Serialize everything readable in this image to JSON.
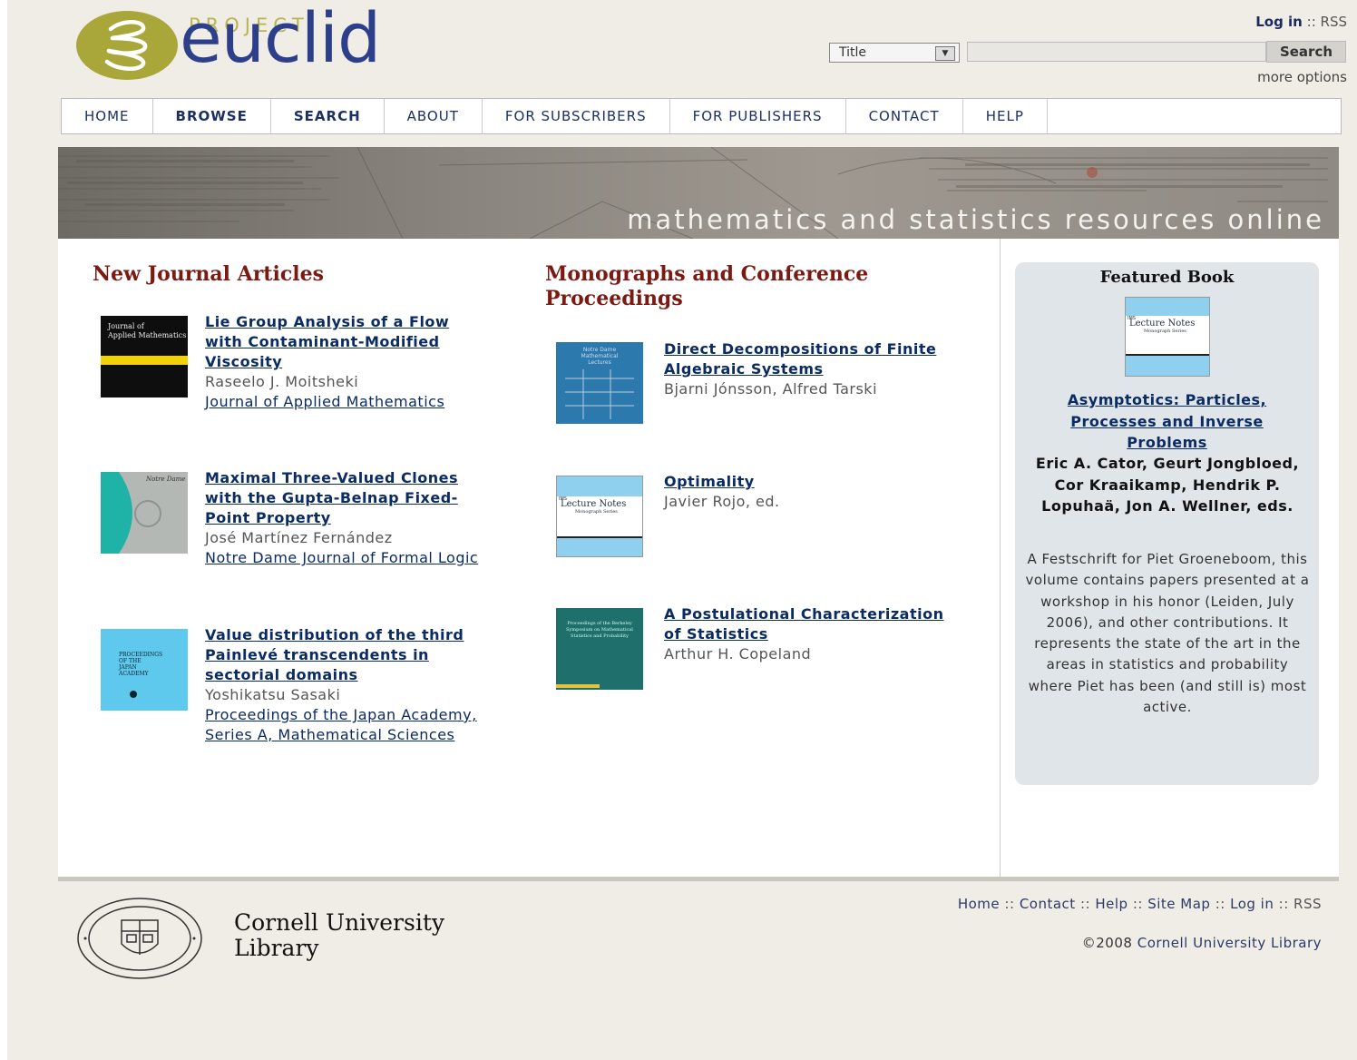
{
  "header": {
    "project": "PROJECT",
    "brand": "euclid",
    "login_label": "Log in",
    "sep": "::",
    "rss": "RSS",
    "search_field_selected": "Title",
    "search_value": "",
    "search_button": "Search",
    "more_options": "more options"
  },
  "nav": [
    "HOME",
    "BROWSE",
    "SEARCH",
    "ABOUT",
    "FOR SUBSCRIBERS",
    "FOR PUBLISHERS",
    "CONTACT",
    "HELP"
  ],
  "banner": {
    "text": "mathematics and statistics resources online"
  },
  "journals": {
    "heading": "New Journal Articles",
    "items": [
      {
        "title": "Lie Group Analysis of a Flow with Contaminant-Modified Viscosity",
        "author": "Raseelo J. Moitsheki",
        "journal": "Journal of Applied Mathematics"
      },
      {
        "title": "Maximal Three-Valued Clones with the Gupta-Belnap Fixed-Point Property",
        "author": "José Martínez Fernández",
        "journal": "Notre Dame Journal of Formal Logic"
      },
      {
        "title": "Value distribution of the third Painlevé transcendents in sectorial domains",
        "author": "Yoshikatsu Sasaki",
        "journal": "Proceedings of the Japan Academy, Series A, Mathematical Sciences"
      }
    ]
  },
  "monographs": {
    "heading": "Monographs and Conference Proceedings",
    "items": [
      {
        "title": "Direct Decompositions of Finite Algebraic Systems",
        "author": "Bjarni Jónsson, Alfred Tarski"
      },
      {
        "title": "Optimality",
        "author": "Javier Rojo, ed."
      },
      {
        "title": "A Postulational Characterization of Statistics",
        "author": "Arthur H. Copeland"
      }
    ]
  },
  "featured": {
    "heading": "Featured Book",
    "title": "Asymptotics: Particles, Processes and Inverse Problems",
    "authors": "Eric A. Cator, Geurt Jongbloed, Cor Kraaikamp, Hendrik P. Lopuhaä, Jon A. Wellner, eds.",
    "description": "A Festschrift for Piet Groeneboom, this volume contains papers presented at a workshop in his honor (Leiden, July 2006), and other contributions. It represents the state of the art in the areas in statistics and probability where Piet has been (and still is) most active."
  },
  "covers": {
    "jam": {
      "line1": "Journal of",
      "line2": "Applied Mathematics"
    },
    "ndj": {
      "line1": "Notre Dame"
    },
    "lecture": {
      "ims": "IMS",
      "line1": "Lecture Notes",
      "line2": "Monograph Series"
    },
    "ndml": {
      "line1": "Notre Dame",
      "line2": "Mathematical",
      "line3": "Lectures"
    },
    "berkeley": {
      "text": "Proceedings of the Berkeley Symposium on Mathematical Statistics and Probability"
    },
    "pja": {
      "line1": "PROCEEDINGS",
      "line2": "OF THE",
      "line3": "JAPAN",
      "line4": "ACADEMY"
    }
  },
  "footer": {
    "institution_line1": "Cornell University",
    "institution_line2": "Library",
    "links": [
      "Home",
      "Contact",
      "Help",
      "Site Map",
      "Log in"
    ],
    "sep": "::",
    "rss": "RSS",
    "copyright": "©2008",
    "copyright_link": "Cornell University Library"
  },
  "colors": {
    "page_bg": "#f0ede6",
    "heading_red": "#7a1a12",
    "link_navy": "#0b2b63",
    "logo_olive": "#a9a73a",
    "logo_blue": "#2d3f8b",
    "featured_bg": "#dfe5e8"
  },
  "icons": [
    "euclid-logo-icon",
    "cornell-seal-icon",
    "dropdown-arrow-icon"
  ]
}
